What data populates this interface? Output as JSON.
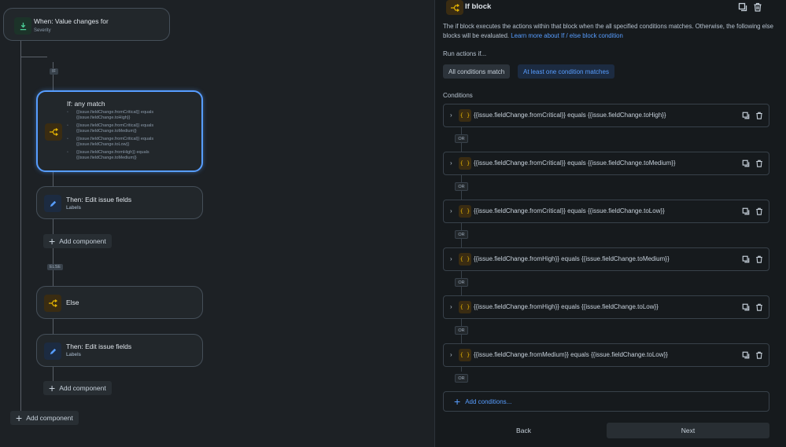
{
  "trigger": {
    "title": "When: Value changes for",
    "subtitle": "Severity"
  },
  "labels": {
    "if_chip": "IF",
    "else_chip": "ELSE"
  },
  "if_node": {
    "title": "If: any match",
    "conditions": [
      "{{issue.fieldChange.fromCritical}} equals {{issue.fieldChange.toHigh}}",
      "{{issue.fieldChange.fromCritical}} equals {{issue.fieldChange.toMedium}}",
      "{{issue.fieldChange.fromCritical}} equals {{issue.fieldChange.toLow}}",
      "{{issue.fieldChange.fromHigh}} equals {{issue.fieldChange.toMedium}}"
    ]
  },
  "then1": {
    "title": "Then: Edit issue fields",
    "subtitle": "Labels"
  },
  "add_component_1": "Add component",
  "else_node": {
    "title": "Else"
  },
  "then2": {
    "title": "Then: Edit issue fields",
    "subtitle": "Labels"
  },
  "add_component_2": "Add component",
  "add_component_root": "Add component",
  "panel": {
    "title": "If block",
    "description": "The if block executes the actions within that block when the all specified conditions matches. Otherwise, the following else blocks will be evaluated.",
    "learn_more": "Learn more about If / else block condition",
    "run_label": "Run actions if...",
    "option_all": "All conditions match",
    "option_any": "At least one condition matches",
    "selected_option": "At least one condition matches",
    "conditions_label": "Conditions",
    "conditions": [
      "{{issue.fieldChange.fromCritical}} equals {{issue.fieldChange.toHigh}}",
      "{{issue.fieldChange.fromCritical}} equals {{issue.fieldChange.toMedium}}",
      "{{issue.fieldChange.fromCritical}} equals {{issue.fieldChange.toLow}}",
      "{{issue.fieldChange.fromHigh}} equals {{issue.fieldChange.toMedium}}",
      "{{issue.fieldChange.fromHigh}} equals {{issue.fieldChange.toLow}}",
      "{{issue.fieldChange.fromMedium}} equals {{issue.fieldChange.toLow}}"
    ],
    "or_label": "OR",
    "add_conditions": "Add conditions...",
    "back": "Back",
    "next": "Next"
  },
  "colors": {
    "accent": "#579dff",
    "background": "#1d2125",
    "panel": "#161a1d",
    "branch": "#e2b203"
  }
}
